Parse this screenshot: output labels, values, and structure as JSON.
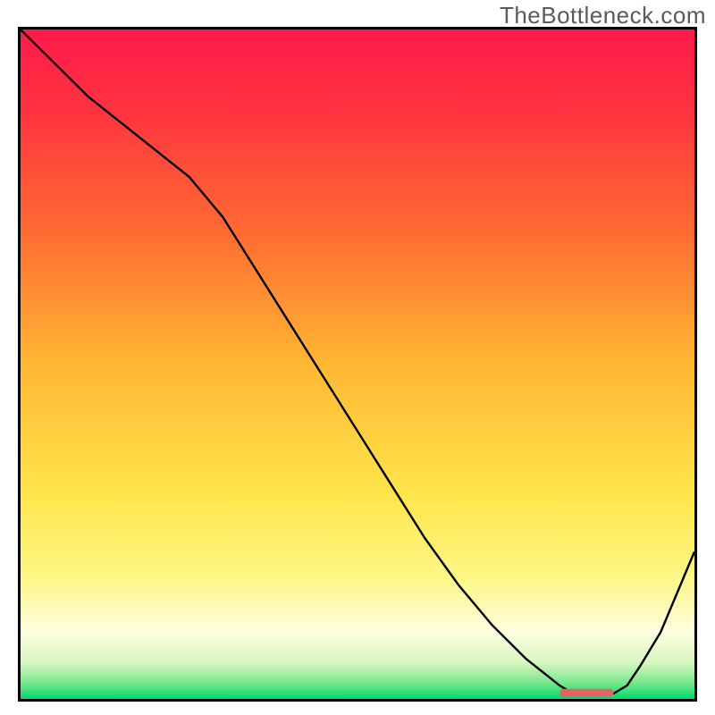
{
  "watermark": "TheBottleneck.com",
  "chart_data": {
    "type": "line",
    "title": "",
    "xlabel": "",
    "ylabel": "",
    "xlim": [
      0,
      100
    ],
    "ylim": [
      0,
      100
    ],
    "background_gradient_stops": [
      {
        "offset": 0.0,
        "color": "#ff1a4b"
      },
      {
        "offset": 0.12,
        "color": "#ff3340"
      },
      {
        "offset": 0.3,
        "color": "#ff6a33"
      },
      {
        "offset": 0.5,
        "color": "#ffb733"
      },
      {
        "offset": 0.7,
        "color": "#ffe64d"
      },
      {
        "offset": 0.82,
        "color": "#fdf787"
      },
      {
        "offset": 0.9,
        "color": "#fffde0"
      },
      {
        "offset": 0.945,
        "color": "#d9f7c2"
      },
      {
        "offset": 0.975,
        "color": "#7de88f"
      },
      {
        "offset": 1.0,
        "color": "#00d96b"
      }
    ],
    "curve": {
      "x": [
        0,
        5,
        10,
        15,
        20,
        25,
        30,
        35,
        40,
        45,
        50,
        55,
        60,
        65,
        70,
        75,
        80,
        82,
        84,
        86,
        88,
        90,
        92,
        95,
        100
      ],
      "y": [
        100,
        95,
        90,
        86,
        82,
        78,
        72,
        64,
        56,
        48,
        40,
        32,
        24,
        17,
        11,
        6,
        2,
        0.8,
        0.5,
        0.5,
        0.8,
        2,
        5,
        10,
        22
      ]
    },
    "optimal_marker": {
      "x_center": 84,
      "width": 8,
      "y": 0.9,
      "color": "#e06666"
    }
  }
}
